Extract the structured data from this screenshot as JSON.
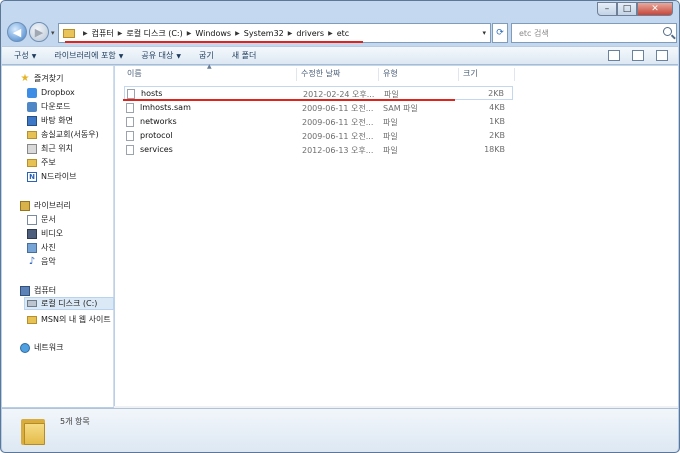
{
  "window": {
    "controls": {
      "minimize": "–",
      "maximize": "□",
      "close": "✕"
    }
  },
  "navbar": {
    "back_icon": "◀",
    "forward_icon": "▶",
    "breadcrumbs": [
      "컴퓨터",
      "로컬 디스크 (C:)",
      "Windows",
      "System32",
      "drivers",
      "etc"
    ],
    "search_placeholder": "etc 검색",
    "refresh_icon": "⟳"
  },
  "toolbar": {
    "items": [
      "구성",
      "라이브러리에 포함",
      "공유 대상",
      "굽기",
      "새 폴더"
    ]
  },
  "sidebar": {
    "favorites": {
      "label": "즐겨찾기",
      "items": [
        "Dropbox",
        "다운로드",
        "바탕 화면",
        "송실교회(서동우)",
        "최근 위치",
        "주보",
        "N드라이브"
      ]
    },
    "libraries": {
      "label": "라이브러리",
      "items": [
        "문서",
        "비디오",
        "사진",
        "음악"
      ]
    },
    "computer": {
      "label": "컴퓨터",
      "items": [
        "로컬 디스크 (C:)",
        "MSN의 내 웹 사이트"
      ]
    },
    "network": {
      "label": "네트워크"
    }
  },
  "list": {
    "columns": {
      "name": "이름",
      "date": "수정한 날짜",
      "type": "유형",
      "size": "크기"
    },
    "rows": [
      {
        "name": "hosts",
        "date": "2012-02-24 오후...",
        "type": "파일",
        "size": "2KB"
      },
      {
        "name": "lmhosts.sam",
        "date": "2009-06-11 오전...",
        "type": "SAM 파일",
        "size": "4KB"
      },
      {
        "name": "networks",
        "date": "2009-06-11 오전...",
        "type": "파일",
        "size": "1KB"
      },
      {
        "name": "protocol",
        "date": "2009-06-11 오전...",
        "type": "파일",
        "size": "2KB"
      },
      {
        "name": "services",
        "date": "2012-06-13 오후...",
        "type": "파일",
        "size": "18KB"
      }
    ]
  },
  "details": {
    "item_count": "5개 항목"
  },
  "colors": {
    "highlight_underline": "#e0231b",
    "window_frame": "#b6cde8"
  }
}
